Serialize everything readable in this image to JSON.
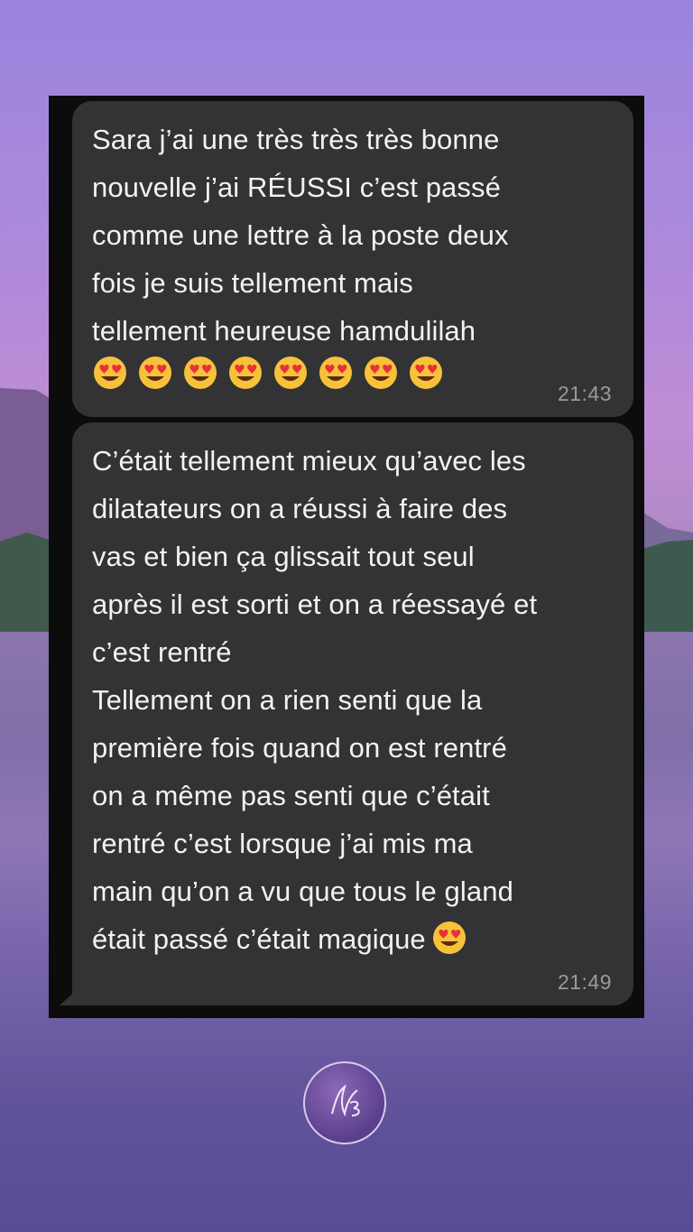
{
  "messages": [
    {
      "text": "Sara j’ai une très très très bonne\nnouvelle j’ai RÉUSSI c’est passé\ncomme une lettre à la poste deux\nfois je suis tellement mais\ntellement heureuse hamdulilah",
      "emoji": "smiling-face-with-heart-eyes",
      "emoji_count": 8,
      "time": "21:43"
    },
    {
      "text": "C’était tellement mieux qu’avec les\ndilatateurs on a réussi à faire des\nvas et bien ça glissait tout seul\naprès il est sorti et on a réessayé et\nc’est rentré\nTellement on a rien senti que la\npremière fois quand on est rentré\non a même pas senti que c’était\nrentré c’est lorsque j’ai mis ma\nmain qu’on a vu que tous le gland\nétait passé c’était magique",
      "emoji": "smiling-face-with-heart-eyes",
      "emoji_count": 1,
      "time": "21:49"
    }
  ],
  "colors": {
    "bubble": "#333335",
    "panel": "#0c0c0c",
    "text": "#f2f2f2",
    "time": "#9a9a9a"
  },
  "logo": {
    "icon": "monogram-logo"
  }
}
